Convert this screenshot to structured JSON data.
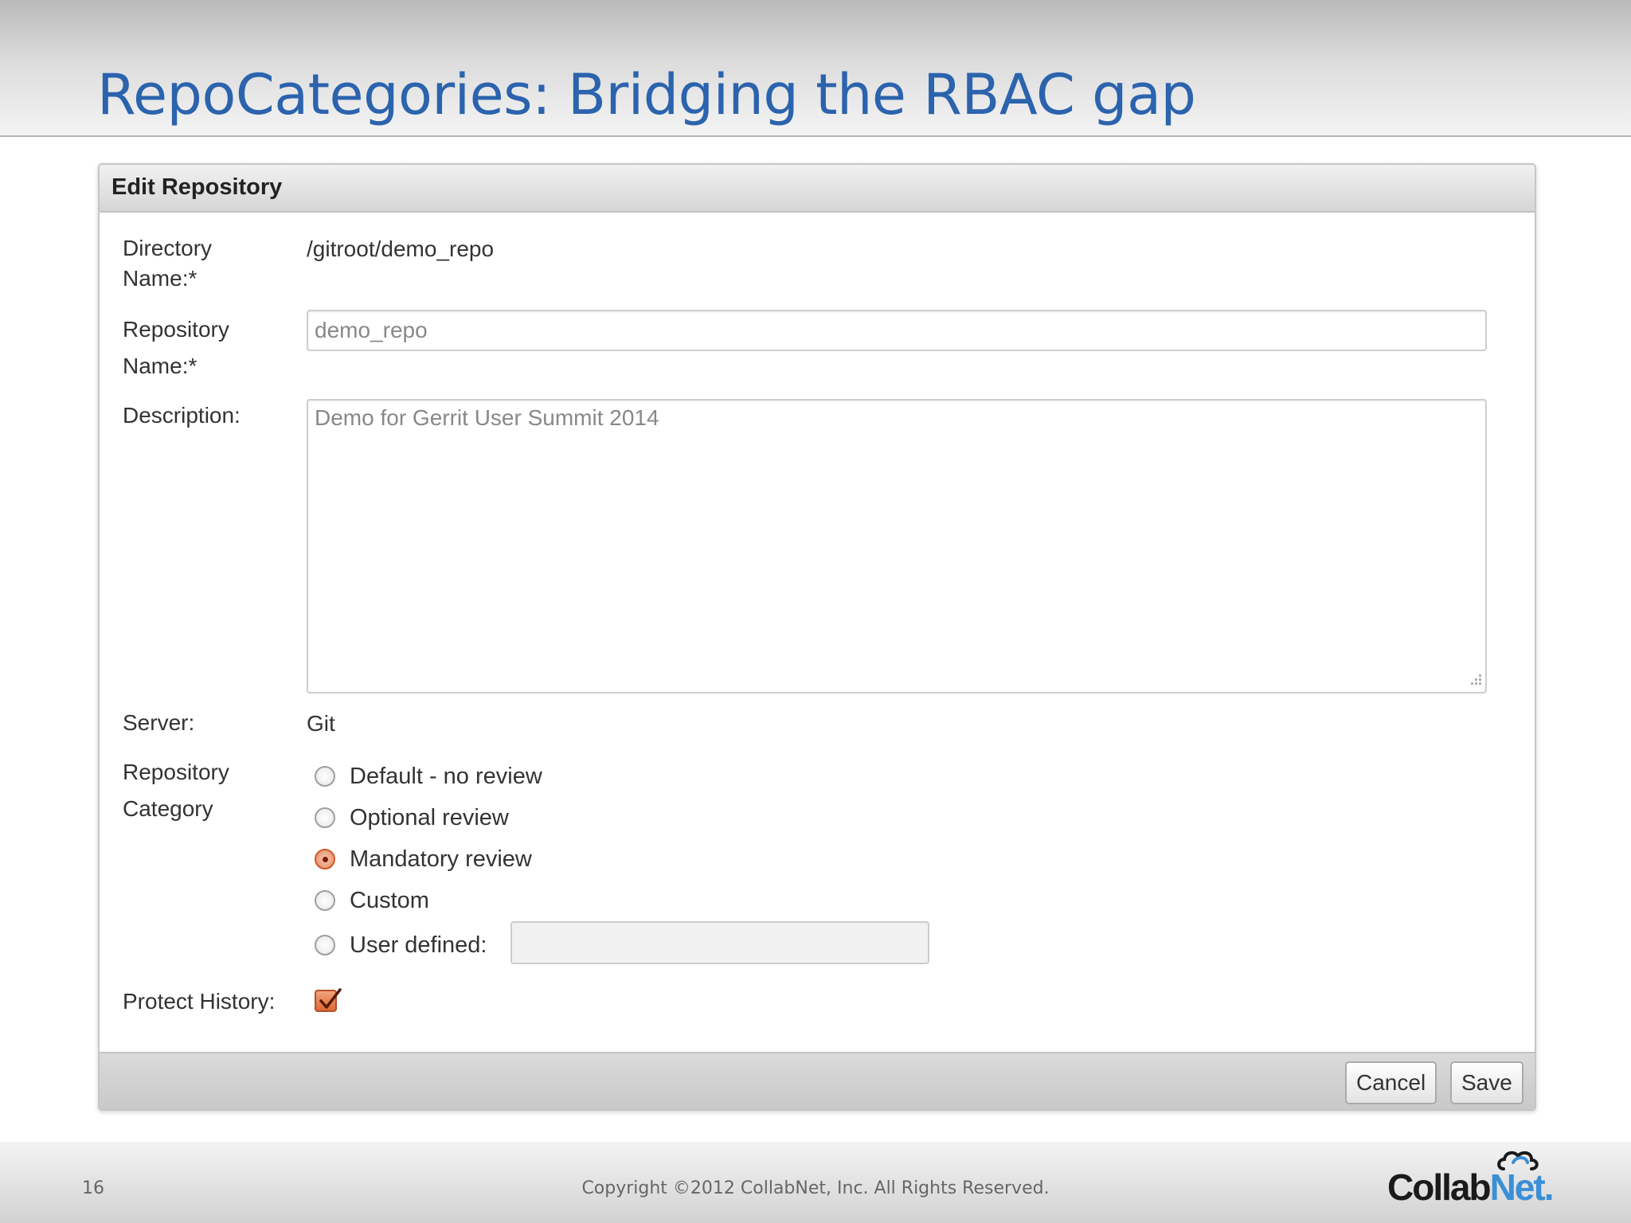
{
  "slide": {
    "title": "RepoCategories: Bridging the RBAC gap",
    "page_number": "16",
    "copyright": "Copyright ©2012 CollabNet, Inc.  All Rights Reserved.",
    "logo": {
      "part1": "Collab",
      "part2": "Net",
      "suffix": ".",
      "color_dark": "#1a1a1a",
      "color_accent": "#3a8fd6"
    }
  },
  "form": {
    "title": "Edit Repository",
    "directory": {
      "label_line1": "Directory",
      "label_line2": "Name:*",
      "value": "/gitroot/demo_repo"
    },
    "repository_name": {
      "label_line1": "Repository",
      "label_line2": "Name:*",
      "value": "demo_repo"
    },
    "description": {
      "label": "Description:",
      "value": "Demo for Gerrit User Summit 2014"
    },
    "server": {
      "label": "Server:",
      "value": "Git"
    },
    "category": {
      "label_line1": "Repository",
      "label_line2": "Category",
      "options": [
        {
          "label": "Default - no review",
          "checked": false
        },
        {
          "label": "Optional review",
          "checked": false
        },
        {
          "label": "Mandatory review",
          "checked": true
        },
        {
          "label": "Custom",
          "checked": false
        },
        {
          "label": "User defined:",
          "checked": false
        }
      ],
      "user_defined_value": ""
    },
    "protect_history": {
      "label": "Protect History:",
      "checked": true
    },
    "buttons": {
      "cancel": "Cancel",
      "save": "Save"
    }
  },
  "colors": {
    "title_blue": "#2b63ad",
    "accent_orange": "#dd6a36"
  }
}
